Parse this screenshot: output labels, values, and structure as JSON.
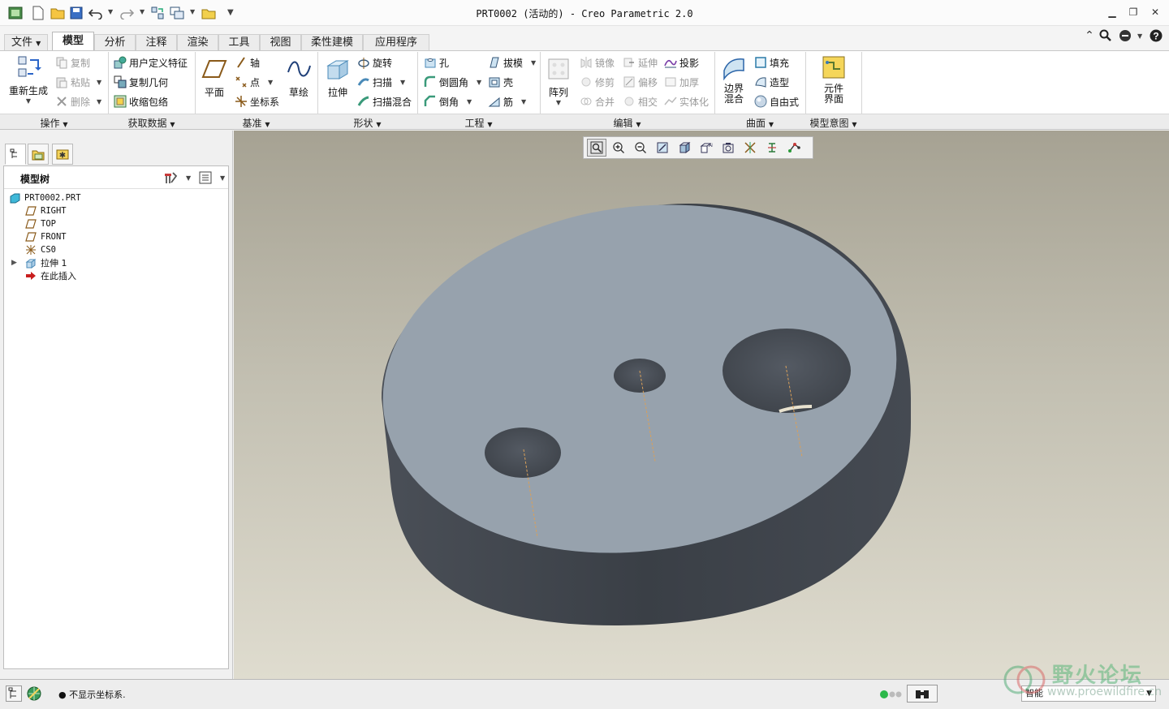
{
  "window": {
    "title": "PRT0002 (活动的) - Creo Parametric 2.0"
  },
  "tabs": [
    "文件",
    "模型",
    "分析",
    "注释",
    "渲染",
    "工具",
    "视图",
    "柔性建模",
    "应用程序"
  ],
  "ribbon": {
    "operations": {
      "regenerate": "重新生成",
      "copy": "复制",
      "paste": "粘贴",
      "delete": "删除",
      "group": "操作"
    },
    "get_data": {
      "udf": "用户定义特征",
      "copy_geom": "复制几何",
      "shrinkwrap": "收缩包络",
      "group": "获取数据"
    },
    "datum": {
      "plane": "平面",
      "axis": "轴",
      "point": "点",
      "csys": "坐标系",
      "sketch": "草绘",
      "group": "基准"
    },
    "shapes": {
      "extrude": "拉伸",
      "revolve": "旋转",
      "sweep": "扫描",
      "swept_blend": "扫描混合",
      "group": "形状"
    },
    "engineering": {
      "hole": "孔",
      "round": "倒圆角",
      "chamfer": "倒角",
      "draft": "拔模",
      "shell": "壳",
      "rib": "筋",
      "group": "工程"
    },
    "editing": {
      "pattern": "阵列",
      "mirror": "镜像",
      "trim": "修剪",
      "merge": "合并",
      "extend": "延伸",
      "offset": "偏移",
      "intersect": "相交",
      "project": "投影",
      "thicken": "加厚",
      "solidify": "实体化",
      "group": "编辑"
    },
    "surfaces": {
      "boundary_blend": "边界\n混合",
      "fill": "填充",
      "style": "造型",
      "freestyle": "自由式",
      "group": "曲面"
    },
    "model_intent": {
      "component_interface": "元件\n界面",
      "group": "模型意图"
    }
  },
  "model_tree": {
    "title": "模型树",
    "items": [
      {
        "label": "PRT0002.PRT",
        "icon": "part-icon"
      },
      {
        "label": "RIGHT",
        "icon": "datum-plane-icon"
      },
      {
        "label": "TOP",
        "icon": "datum-plane-icon"
      },
      {
        "label": "FRONT",
        "icon": "datum-plane-icon"
      },
      {
        "label": "CS0",
        "icon": "csys-icon"
      },
      {
        "label": "拉伸 1",
        "icon": "extrude-icon"
      },
      {
        "label": "在此插入",
        "icon": "insert-here-icon"
      }
    ]
  },
  "status": {
    "message": "● 不显示坐标系.",
    "filter": "智能"
  },
  "watermark": {
    "name": "野火论坛",
    "url": "www.proewildfire.cn"
  },
  "colors": {
    "accent": "#1e6fb8",
    "model_top": "#97a2ad",
    "model_side": "#3f444b"
  }
}
